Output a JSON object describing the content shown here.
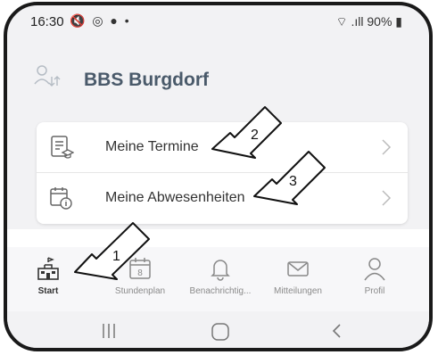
{
  "status_bar": {
    "time": "16:30",
    "icons": "🔇 ◎ ● •",
    "right": "⌔ .ıll 90% ▮"
  },
  "header": {
    "school_name": "BBS Burgdorf"
  },
  "menu": {
    "items": [
      {
        "label": "Meine Termine",
        "icon": "calendar-graduation-icon"
      },
      {
        "label": "Meine Abwesenheiten",
        "icon": "calendar-info-icon"
      }
    ]
  },
  "nav": {
    "items": [
      {
        "label": "Start",
        "icon": "school-building-icon",
        "active": true
      },
      {
        "label": "Stundenplan",
        "icon": "calendar-8-icon"
      },
      {
        "label": "Benachrichtig...",
        "icon": "bell-icon"
      },
      {
        "label": "Mitteilungen",
        "icon": "envelope-icon"
      },
      {
        "label": "Profil",
        "icon": "person-icon"
      }
    ]
  },
  "annotations": {
    "arrow1": "1",
    "arrow2": "2",
    "arrow3": "3"
  },
  "colors": {
    "accent": "#4a5a6a",
    "active_nav": "#333333"
  }
}
